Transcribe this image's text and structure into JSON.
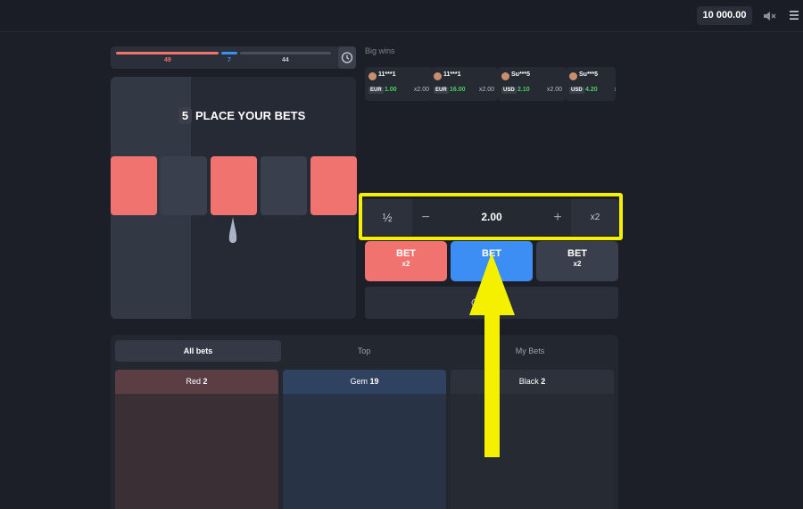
{
  "topbar": {
    "balance": "10 000.00",
    "icons": [
      "sound-muted-icon",
      "hamburger-menu-icon"
    ]
  },
  "progress": {
    "red_count": "49",
    "blue_count": "7",
    "black_count": "44",
    "history_icon": "clock-history-icon"
  },
  "game": {
    "round_number": "5",
    "title": "PLACE YOUR BETS",
    "tiles": [
      "red",
      "dark",
      "red",
      "dark",
      "red"
    ]
  },
  "big_wins": {
    "title": "Big wins",
    "items": [
      {
        "user": "11***1",
        "currency": "EUR",
        "amount": "1.00",
        "multiplier": "x2.00"
      },
      {
        "user": "11***1",
        "currency": "EUR",
        "amount": "16.00",
        "multiplier": "x2.00"
      },
      {
        "user": "Su***5",
        "currency": "USD",
        "amount": "2.10",
        "multiplier": "x2.00"
      },
      {
        "user": "Su***5",
        "currency": "USD",
        "amount": "4.20",
        "multiplier": "x2"
      }
    ]
  },
  "bet_control": {
    "half": "½",
    "minus": "−",
    "value": "2.00",
    "plus": "+",
    "double": "x2"
  },
  "bet_buttons": [
    {
      "label": "BET",
      "multiplier": "x2"
    },
    {
      "label": "BET",
      "multiplier": ""
    },
    {
      "label": "BET",
      "multiplier": "x2"
    }
  ],
  "autoplay": {
    "label": "y"
  },
  "tabs": [
    "All bets",
    "Top",
    "My Bets"
  ],
  "columns": [
    {
      "name": "Red",
      "count": "2"
    },
    {
      "name": "Gem",
      "count": "19"
    },
    {
      "name": "Black",
      "count": "2"
    }
  ],
  "colors": {
    "red": "#f07370",
    "blue": "#3d8ef4",
    "dark": "#3a3f4d",
    "highlight": "#f4f000"
  }
}
